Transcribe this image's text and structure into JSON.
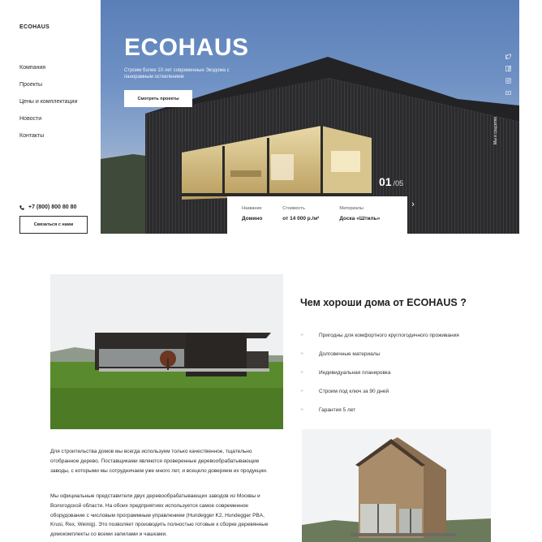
{
  "sidebar": {
    "logo": "ECOHAUS",
    "nav": [
      "Компания",
      "Проекты",
      "Цены и комплектации",
      "Новости",
      "Контакты"
    ],
    "phone": "+7 (800) 800 80 80",
    "contact_button": "Связаться с нами"
  },
  "hero": {
    "title": "ECOHAUS",
    "subtitle": "Строим более 10 лет современные Экодома с панорамным остеклением",
    "button": "Смотреть проекты",
    "slide_current": "01",
    "slide_total": "/05",
    "social_icons": [
      "twitter-icon",
      "facebook-icon",
      "instagram-icon",
      "youtube-icon"
    ],
    "social_caption": "Мы в соцсетях"
  },
  "project_card": {
    "columns": [
      {
        "label": "Название",
        "value": "Домино"
      },
      {
        "label": "Стоимость",
        "value": "от 14 000 р./м²"
      },
      {
        "label": "Материалы",
        "value": "Доска «Штиль»"
      }
    ]
  },
  "why": {
    "title": "Чем хороши дома от ECOHAUS ?",
    "items": [
      "Пригодны для комфортного круглогодичного проживания",
      "Долговечные материалы",
      "Индивидуальная планировка",
      "Строим под ключ за 90 дней",
      "Гарантия 5 лет"
    ]
  },
  "about": {
    "paragraph1": "Для строительства домов мы всегда используем только качественное, тщательно отобранное дерево. Поставщиками являются проверенные деревообрабатывающие заводы, с которыми мы сотрудничаем уже много лет, и всецело доверяем их продукции.",
    "paragraph2": "Мы официальные представители двух деревообрабатывающих заводов из Москвы и Вологодской области. На обоих предприятиях используется самое современное оборудование с числовым программным управлением (Hundegger K2, Hundegger PBA, Krusi, Rex, Weinig). Это позволяет производить полностью готовые к сборке деревянные домокомплекты со всеми запилами и чашками."
  },
  "colors": {
    "accent": "#1f1f1f",
    "hero_sky": "#6f91c4",
    "card_bg": "#ffffff"
  }
}
